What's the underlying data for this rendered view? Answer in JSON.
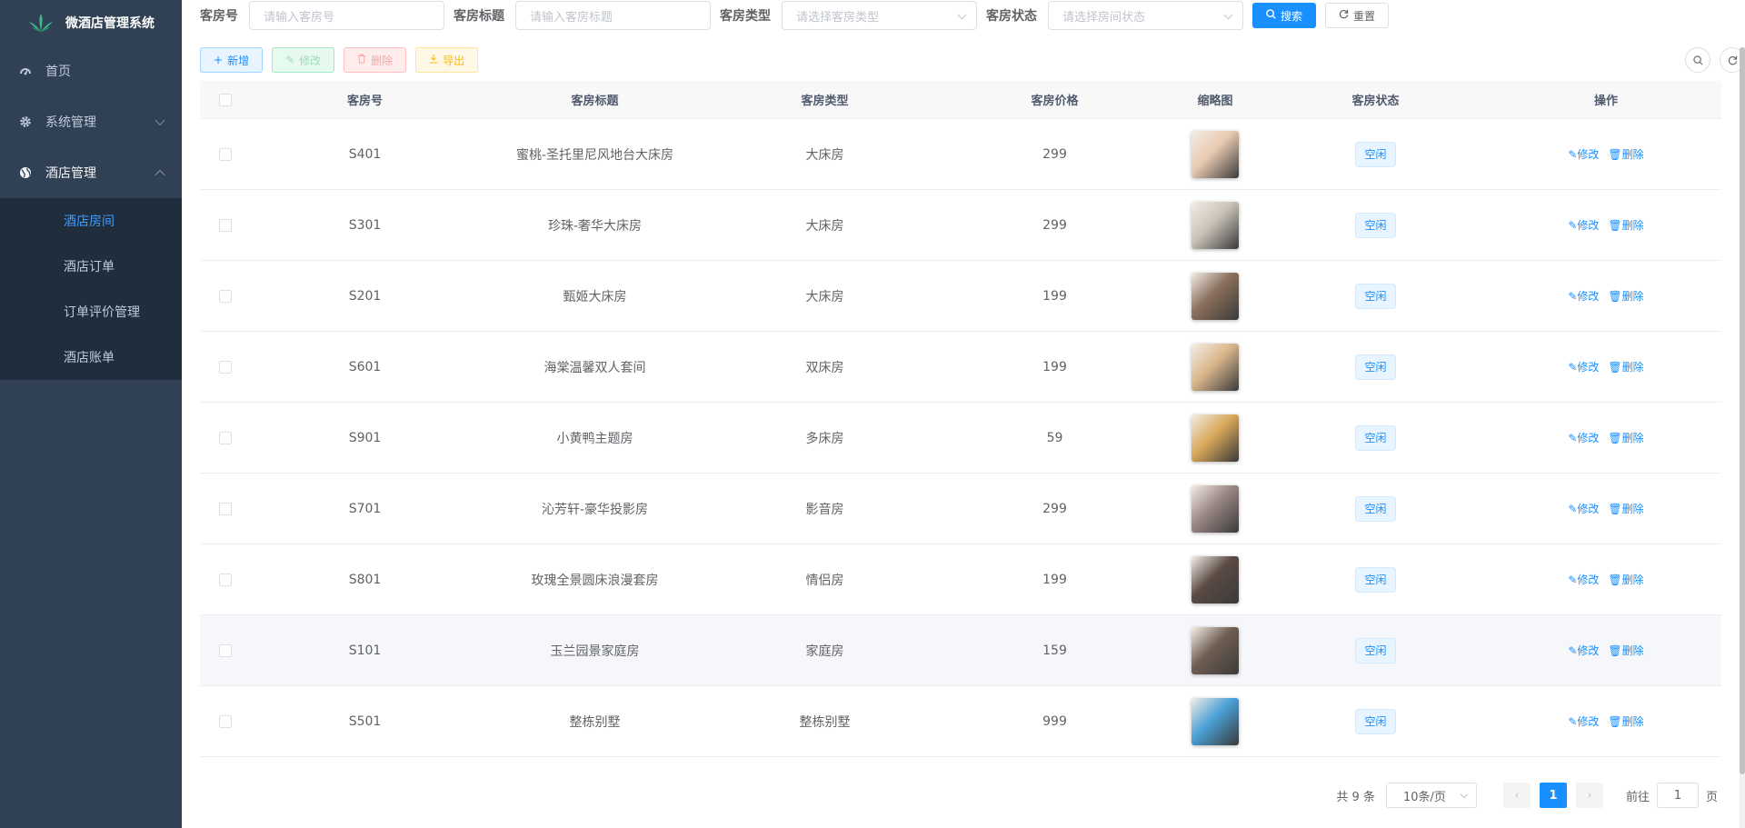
{
  "app": {
    "title": "微酒店管理系统",
    "brand_color": "#1890ff",
    "sidebar_color": "#304156"
  },
  "sidebar": {
    "items": [
      {
        "label": "首页",
        "icon": "dashboard-icon"
      },
      {
        "label": "系统管理",
        "icon": "gear-icon"
      },
      {
        "label": "酒店管理",
        "icon": "globe-icon"
      }
    ],
    "submenu": [
      {
        "label": "酒店房间",
        "active": true
      },
      {
        "label": "酒店订单"
      },
      {
        "label": "订单评价管理"
      },
      {
        "label": "酒店账单"
      }
    ]
  },
  "search": {
    "room_no_label": "客房号",
    "room_no_placeholder": "请输入客房号",
    "room_title_label": "客房标题",
    "room_title_placeholder": "请输入客房标题",
    "room_type_label": "客房类型",
    "room_type_placeholder": "请选择客房类型",
    "room_status_label": "客房状态",
    "room_status_placeholder": "请选择房间状态",
    "search_btn": "搜索",
    "reset_btn": "重置"
  },
  "toolbar": {
    "add": "新增",
    "edit": "修改",
    "delete": "删除",
    "export": "导出"
  },
  "table": {
    "headers": [
      "客房号",
      "客房标题",
      "客房类型",
      "客房价格",
      "缩略图",
      "客房状态",
      "操作"
    ],
    "op_edit": "修改",
    "op_delete": "删除",
    "rows": [
      {
        "no": "S401",
        "title": "蜜桃-圣托里尼风地台大床房",
        "type": "大床房",
        "price": "299",
        "status": "空闲",
        "thumb": "#e8c9b0"
      },
      {
        "no": "S301",
        "title": "珍珠-奢华大床房",
        "type": "大床房",
        "price": "299",
        "status": "空闲",
        "thumb": "#c9c2b8"
      },
      {
        "no": "S201",
        "title": "甄姬大床房",
        "type": "大床房",
        "price": "199",
        "status": "空闲",
        "thumb": "#8a6f5c"
      },
      {
        "no": "S601",
        "title": "海棠温馨双人套间",
        "type": "双床房",
        "price": "199",
        "status": "空闲",
        "thumb": "#d9b78c"
      },
      {
        "no": "S901",
        "title": "小黄鸭主题房",
        "type": "多床房",
        "price": "59",
        "status": "空闲",
        "thumb": "#d9a85a"
      },
      {
        "no": "S701",
        "title": "沁芳轩-豪华投影房",
        "type": "影音房",
        "price": "299",
        "status": "空闲",
        "thumb": "#9a8684"
      },
      {
        "no": "S801",
        "title": "玫瑰全景圆床浪漫套房",
        "type": "情侣房",
        "price": "199",
        "status": "空闲",
        "thumb": "#5a4a44"
      },
      {
        "no": "S101",
        "title": "玉兰园景家庭房",
        "type": "家庭房",
        "price": "159",
        "status": "空闲",
        "thumb": "#6f5d52"
      },
      {
        "no": "S501",
        "title": "整栋别墅",
        "type": "整栋别墅",
        "price": "999",
        "status": "空闲",
        "thumb": "#4a9fd6"
      }
    ]
  },
  "pagination": {
    "total": "共 9 条",
    "page_size": "10条/页",
    "current": "1",
    "goto_prefix": "前往",
    "goto_value": "1",
    "goto_suffix": "页"
  }
}
